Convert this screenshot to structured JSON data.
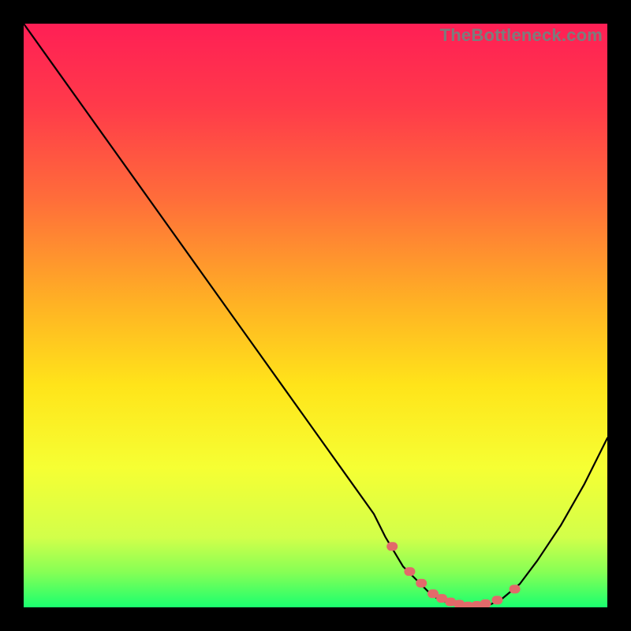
{
  "watermark": "TheBottleneck.com",
  "chart_data": {
    "type": "line",
    "title": "",
    "xlabel": "",
    "ylabel": "",
    "xlim": [
      0,
      100
    ],
    "ylim": [
      0,
      100
    ],
    "grid": false,
    "series": [
      {
        "name": "bottleneck-curve",
        "x": [
          0,
          5,
          10,
          15,
          20,
          25,
          30,
          35,
          40,
          45,
          50,
          55,
          60,
          62,
          65,
          68,
          70,
          72,
          74,
          76,
          78,
          80,
          82,
          85,
          88,
          92,
          96,
          100
        ],
        "y": [
          100,
          93,
          86,
          79,
          72,
          65,
          58,
          51,
          44,
          37,
          30,
          23,
          16,
          12,
          7,
          4,
          2,
          1,
          0.5,
          0,
          0.2,
          0.5,
          1.5,
          4,
          8,
          14,
          21,
          29
        ]
      }
    ],
    "markers": {
      "name": "low-bottleneck-dots",
      "color": "#e26a6a",
      "x": [
        63,
        66,
        68,
        70,
        71.5,
        73,
        74.5,
        76,
        77.5,
        79,
        81,
        84
      ],
      "y": [
        10.5,
        6.2,
        4.2,
        2.4,
        1.6,
        1.0,
        0.6,
        0.3,
        0.4,
        0.7,
        1.3,
        3.2
      ]
    },
    "background_gradient_stops": [
      {
        "pct": 0,
        "color": "#ff1f55"
      },
      {
        "pct": 14,
        "color": "#ff3a4a"
      },
      {
        "pct": 30,
        "color": "#ff6d3a"
      },
      {
        "pct": 48,
        "color": "#ffb224"
      },
      {
        "pct": 62,
        "color": "#ffe41a"
      },
      {
        "pct": 76,
        "color": "#f6ff33"
      },
      {
        "pct": 88,
        "color": "#d2ff4a"
      },
      {
        "pct": 94,
        "color": "#86ff55"
      },
      {
        "pct": 100,
        "color": "#1aff6f"
      }
    ]
  }
}
